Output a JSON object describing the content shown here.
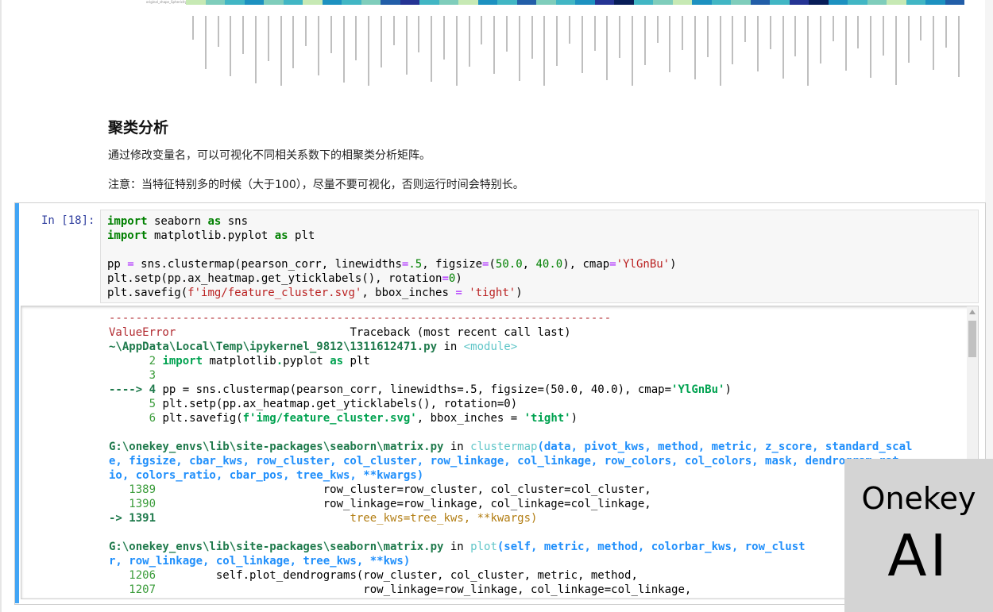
{
  "heatmap": {
    "row_label": "original_shape_Sphericity",
    "colors": [
      "#c7e9b4",
      "#7fcdbb",
      "#41b6c4",
      "#1d91c0",
      "#7fcdbb",
      "#41b6c4",
      "#c7e9b4",
      "#1d91c0",
      "#41b6c4",
      "#7fcdbb",
      "#225ea8",
      "#253494",
      "#41b6c4",
      "#7fcdbb",
      "#c7e9b4",
      "#1d91c0",
      "#41b6c4",
      "#225ea8",
      "#7fcdbb",
      "#41b6c4",
      "#1d91c0",
      "#253494",
      "#081d58",
      "#41b6c4",
      "#7fcdbb",
      "#c7e9b4",
      "#1d91c0",
      "#41b6c4",
      "#7fcdbb",
      "#225ea8",
      "#41b6c4",
      "#253494",
      "#081d58",
      "#1d91c0",
      "#41b6c4",
      "#7fcdbb",
      "#c7e9b4",
      "#41b6c4",
      "#1d91c0",
      "#225ea8"
    ]
  },
  "markdown": {
    "title": "聚类分析",
    "para1": "通过修改变量名，可以可视化不同相关系数下的相聚类分析矩阵。",
    "para2": "注意：当特征特别多的时候（大于100），尽量不要可视化，否则运行时间会特别长。"
  },
  "cell": {
    "prompt": "In  [18]:",
    "code": {
      "l1_kw": "import",
      "l1_rest": " seaborn ",
      "l1_as": "as",
      "l1_end": " sns",
      "l2_kw": "import",
      "l2_rest": " matplotlib.pyplot ",
      "l2_as": "as",
      "l2_end": " plt",
      "l4a": "pp ",
      "l4eq": "=",
      "l4b": " sns.clustermap(pearson_corr, linewidths",
      "l4eq2": "=",
      "l4num": ".5",
      "l4c": ", figsize",
      "l4eq3": "=",
      "l4d": "(",
      "l4n1": "50.0",
      "l4e": ", ",
      "l4n2": "40.0",
      "l4f": "), cmap",
      "l4eq4": "=",
      "l4str": "'YlGnBu'",
      "l4g": ")",
      "l5a": "plt.setp(pp.ax_heatmap.get_yticklabels(), rotation",
      "l5eq": "=",
      "l5num": "0",
      "l5b": ")",
      "l6a": "plt.savefig(",
      "l6str": "f'img/feature_cluster.svg'",
      "l6b": ", bbox_inches ",
      "l6eq": "=",
      "l6str2": " 'tight'",
      "l6c": ")"
    }
  },
  "traceback": {
    "dashes": "---------------------------------------------------------------------------",
    "error_type": "ValueError",
    "traceback_label": "                          Traceback (most recent call last)",
    "file1": "~\\AppData\\Local\\Temp\\ipykernel_9812\\1311612471.py",
    "in1": " in ",
    "module1": "<module>",
    "l2_num": "      2 ",
    "l2_kw": "import",
    "l2_rest": " matplotlib",
    "l2_dot": ".",
    "l2_rest2": "pyplot ",
    "l2_as": "as",
    "l2_end": " plt",
    "l3": "      3",
    "l4_arrow": "----> 4 ",
    "l4_text": "pp = sns.clustermap(pearson_corr, linewidths=.5, figsize=(50.0, 40.0), cmap=",
    "l4_str": "'YlGnBu'",
    "l4_end": ")",
    "l5_num": "      5 ",
    "l5_text": "plt.setp(pp.ax_heatmap.get_yticklabels(), rotation=0)",
    "l6_num": "      6 ",
    "l6_text": "plt.savefig(",
    "l6_str": "f'img/feature_cluster.svg'",
    "l6_mid": ", bbox_inches = ",
    "l6_str2": "'tight'",
    "l6_end": ")",
    "file2": "G:\\onekey_envs\\lib\\site-packages\\seaborn\\matrix.py",
    "in2": " in ",
    "func2": "clustermap",
    "args2_line1": "(data, pivot_kws, method, metric, z_score, standard_scal",
    "args2_line2": "e, figsize, cbar_kws, row_cluster, col_cluster, row_linkage, col_linkage, row_colors, col_colors, mask, dendrogram_rat",
    "args2_line3": "io, colors_ratio, cbar_pos, tree_kws, **kwargs)",
    "l1389_num": "   1389 ",
    "l1389_text": "                        row_cluster=row_cluster, col_cluster=col_cluster,",
    "l1390_num": "   1390 ",
    "l1390_text": "                        row_linkage=row_linkage, col_linkage=col_linkage,",
    "l1391_arrow": "-> 1391 ",
    "l1391_text": "                            tree_kws=tree_kws, **kwargs)",
    "file3": "G:\\onekey_envs\\lib\\site-packages\\seaborn\\matrix.py",
    "in3": " in ",
    "func3": "plot",
    "args3_line1": "(self, metric, method, colorbar_kws, row_clust",
    "args3_line2": "r, row_linkage, col_linkage, tree_kws, **kws)",
    "l1206_num": "   1206 ",
    "l1206_text": "        self.plot_dendrograms(row_cluster, col_cluster, metric, method,",
    "l1207_num": "   1207 ",
    "l1207_text": "                              row_linkage=row_linkage, col_linkage=col_linkage,"
  },
  "watermark": {
    "line1": "Onekey",
    "line2": "AI"
  }
}
